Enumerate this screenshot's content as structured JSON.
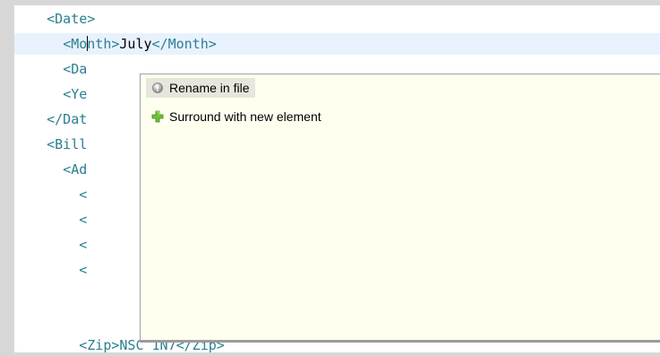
{
  "editor": {
    "lines": [
      {
        "indent": "    ",
        "open": "<Date>",
        "content": "",
        "close": ""
      },
      {
        "indent": "      ",
        "open": "<Mo",
        "open_rest": "nth>",
        "content": "July",
        "close": "</Month>"
      },
      {
        "indent": "      ",
        "open": "<Da",
        "content": "",
        "close": ""
      },
      {
        "indent": "      ",
        "open": "<Ye",
        "content": "",
        "close": ""
      },
      {
        "indent": "    ",
        "open": "</Dat",
        "content": "",
        "close": ""
      },
      {
        "indent": "    ",
        "open": "<Bill",
        "content": "",
        "close": ""
      },
      {
        "indent": "      ",
        "open": "<Ad",
        "content": "",
        "close": ""
      },
      {
        "indent": "        ",
        "open": "<",
        "content": "",
        "close": ""
      },
      {
        "indent": "        ",
        "open": "<",
        "content": "",
        "close": ""
      },
      {
        "indent": "        ",
        "open": "<",
        "content": "",
        "close": ""
      },
      {
        "indent": "        ",
        "open": "<",
        "content": "",
        "close": ""
      },
      {
        "indent": "        ",
        "open": "<Zip>",
        "content": "NSC 1N7",
        "close": "</Zip>"
      }
    ]
  },
  "quick_assist": {
    "proposals": [
      {
        "label": "Rename in file",
        "icon": "rename-icon",
        "selected": true
      },
      {
        "label": "Surround with new element",
        "icon": "add-plus-icon",
        "selected": false
      }
    ]
  }
}
